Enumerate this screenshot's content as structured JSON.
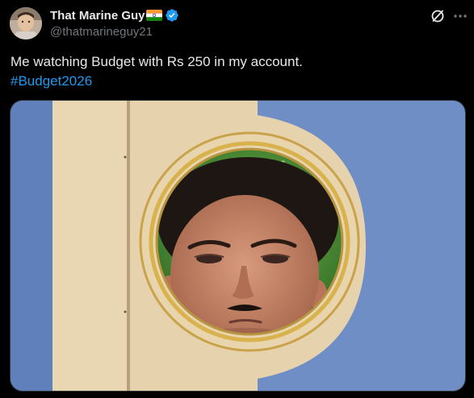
{
  "post": {
    "author": {
      "display_name": "That Marine Guy",
      "handle": "@thatmarineguy21",
      "flag_icon": "india-flag-icon",
      "verified_icon": "verified-badge-icon",
      "verified_color": "#1d9bf0"
    },
    "text": "Me watching Budget with Rs 250 in my account.",
    "hashtag": "#Budget2026",
    "actions": {
      "grok_icon": "grok-icon",
      "more_icon": "more-options-icon"
    },
    "media": {
      "type": "image",
      "alt_description": ""
    }
  },
  "colors": {
    "background": "#000000",
    "text_primary": "#e7e9ea",
    "text_secondary": "#71767b",
    "link": "#1d9bf0",
    "border": "#2f3336"
  }
}
